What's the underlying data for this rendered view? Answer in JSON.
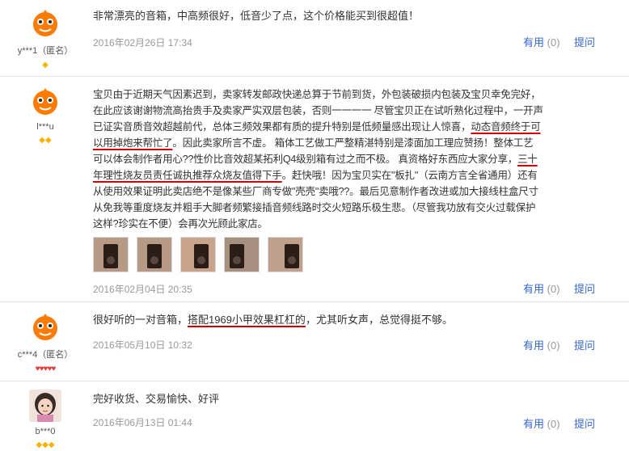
{
  "reviews": [
    {
      "username": "y***1（匿名）",
      "badge": "◆",
      "text": "非常漂亮的音箱，中高频很好，低音少了点，这个价格能买到很超值！",
      "date": "2016年02月26日 17:34",
      "useful_label": "有用",
      "useful_count": "(0)",
      "reply_label": "提问"
    },
    {
      "username": "l***u",
      "badge": "◆◆",
      "text_lines": [
        "宝贝由于近期天气因素迟到，卖家转发邮政快递总算于节前到货，外包装破损内包装及宝贝幸免完好，",
        "在此应该谢谢物流高抬贵手及卖家严实双层包装，否则一一一一 尽管宝贝正在试听熟化过程中，一开声",
        "已证实音质音效超越前代，总体三频效果都有质的提升特别是低频量感出现让人惊喜，",
        "动态音频终于可",
        "以用掉炮来帮忙了",
        "。因此卖家所言不虚。 箱体工艺做工严整精湛特别是漆面加工理应赞扬！整体工艺",
        "可以体会制作者用心??性价比音效超某拓利Q4级别箱有过之而不极。 真资格好东西应大家分享，",
        "三十",
        "年理性烧友员责任诚执推荐众烧友值得下手",
        "。赶快哦！因为宝贝实在\"板扎\"（云南方言全省通用）还有",
        "从使用效果证明此卖店绝不是像某些厂商专做\"壳壳\"卖哦??。最后见意制作者改进或加大接线柱盒尺寸",
        "从免我等重度烧友并粗手大脚者频繁接插音频线路时交火短路乐极生悲。（尽管我功放有交火过载保护",
        "这样?珍实在不便）会再次光顾此家店。"
      ],
      "photos": [
        "photo-1",
        "photo-2",
        "photo-3",
        "photo-4",
        "photo-5"
      ],
      "date": "2016年02月04日 20:35",
      "useful_label": "有用",
      "useful_count": "(0)",
      "reply_label": "提问"
    },
    {
      "username": "c***4（匿名）",
      "badge": "♥♥♥♥♥",
      "text_pre": "很好听的一对音箱，",
      "text_hl": "搭配1969小甲效果杠杠的",
      "text_post": "，尤其听女声，总觉得挺不够。",
      "date": "2016年05月10日 10:32",
      "useful_label": "有用",
      "useful_count": "(0)",
      "reply_label": "提问"
    },
    {
      "username": "b***0",
      "badge": "◆◆◆",
      "text": "完好收货、交易愉快、好评",
      "date": "2016年06月13日 01:44",
      "useful_label": "有用",
      "useful_count": "(0)",
      "reply_label": "提问"
    }
  ],
  "colors": {
    "link": "#3366cc",
    "date": "#999999",
    "underline": "#d40000",
    "badge_gold": "#f4b300",
    "badge_red": "#e23a3a"
  }
}
